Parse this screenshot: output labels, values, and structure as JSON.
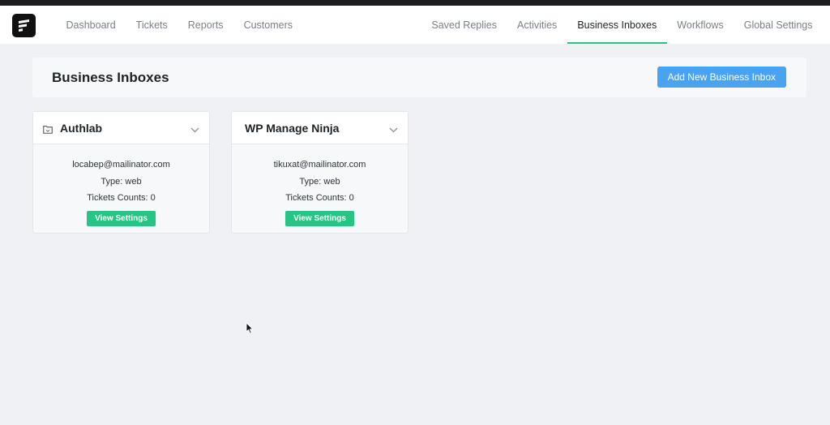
{
  "nav": {
    "left": [
      "Dashboard",
      "Tickets",
      "Reports",
      "Customers"
    ],
    "right": [
      "Saved Replies",
      "Activities",
      "Business Inboxes",
      "Workflows",
      "Global Settings"
    ],
    "active": "Business Inboxes"
  },
  "header": {
    "title": "Business Inboxes",
    "add_label": "Add New Business Inbox"
  },
  "inboxes": [
    {
      "name": "Authlab",
      "email": "locabep@mailinator.com",
      "type": "Type: web",
      "tickets": "Tickets Counts: 0",
      "button": "View Settings",
      "has_folder_icon": true
    },
    {
      "name": "WP Manage Ninja",
      "email": "tikuxat@mailinator.com",
      "type": "Type: web",
      "tickets": "Tickets Counts: 0",
      "button": "View Settings",
      "has_folder_icon": false
    }
  ],
  "colors": {
    "accent": "#26c485",
    "primary_button": "#4aa3f0",
    "background": "#f0f1f4"
  },
  "icons": [
    "app-logo-icon",
    "folder-icon",
    "chevron-down-icon",
    "mouse-cursor-icon"
  ]
}
